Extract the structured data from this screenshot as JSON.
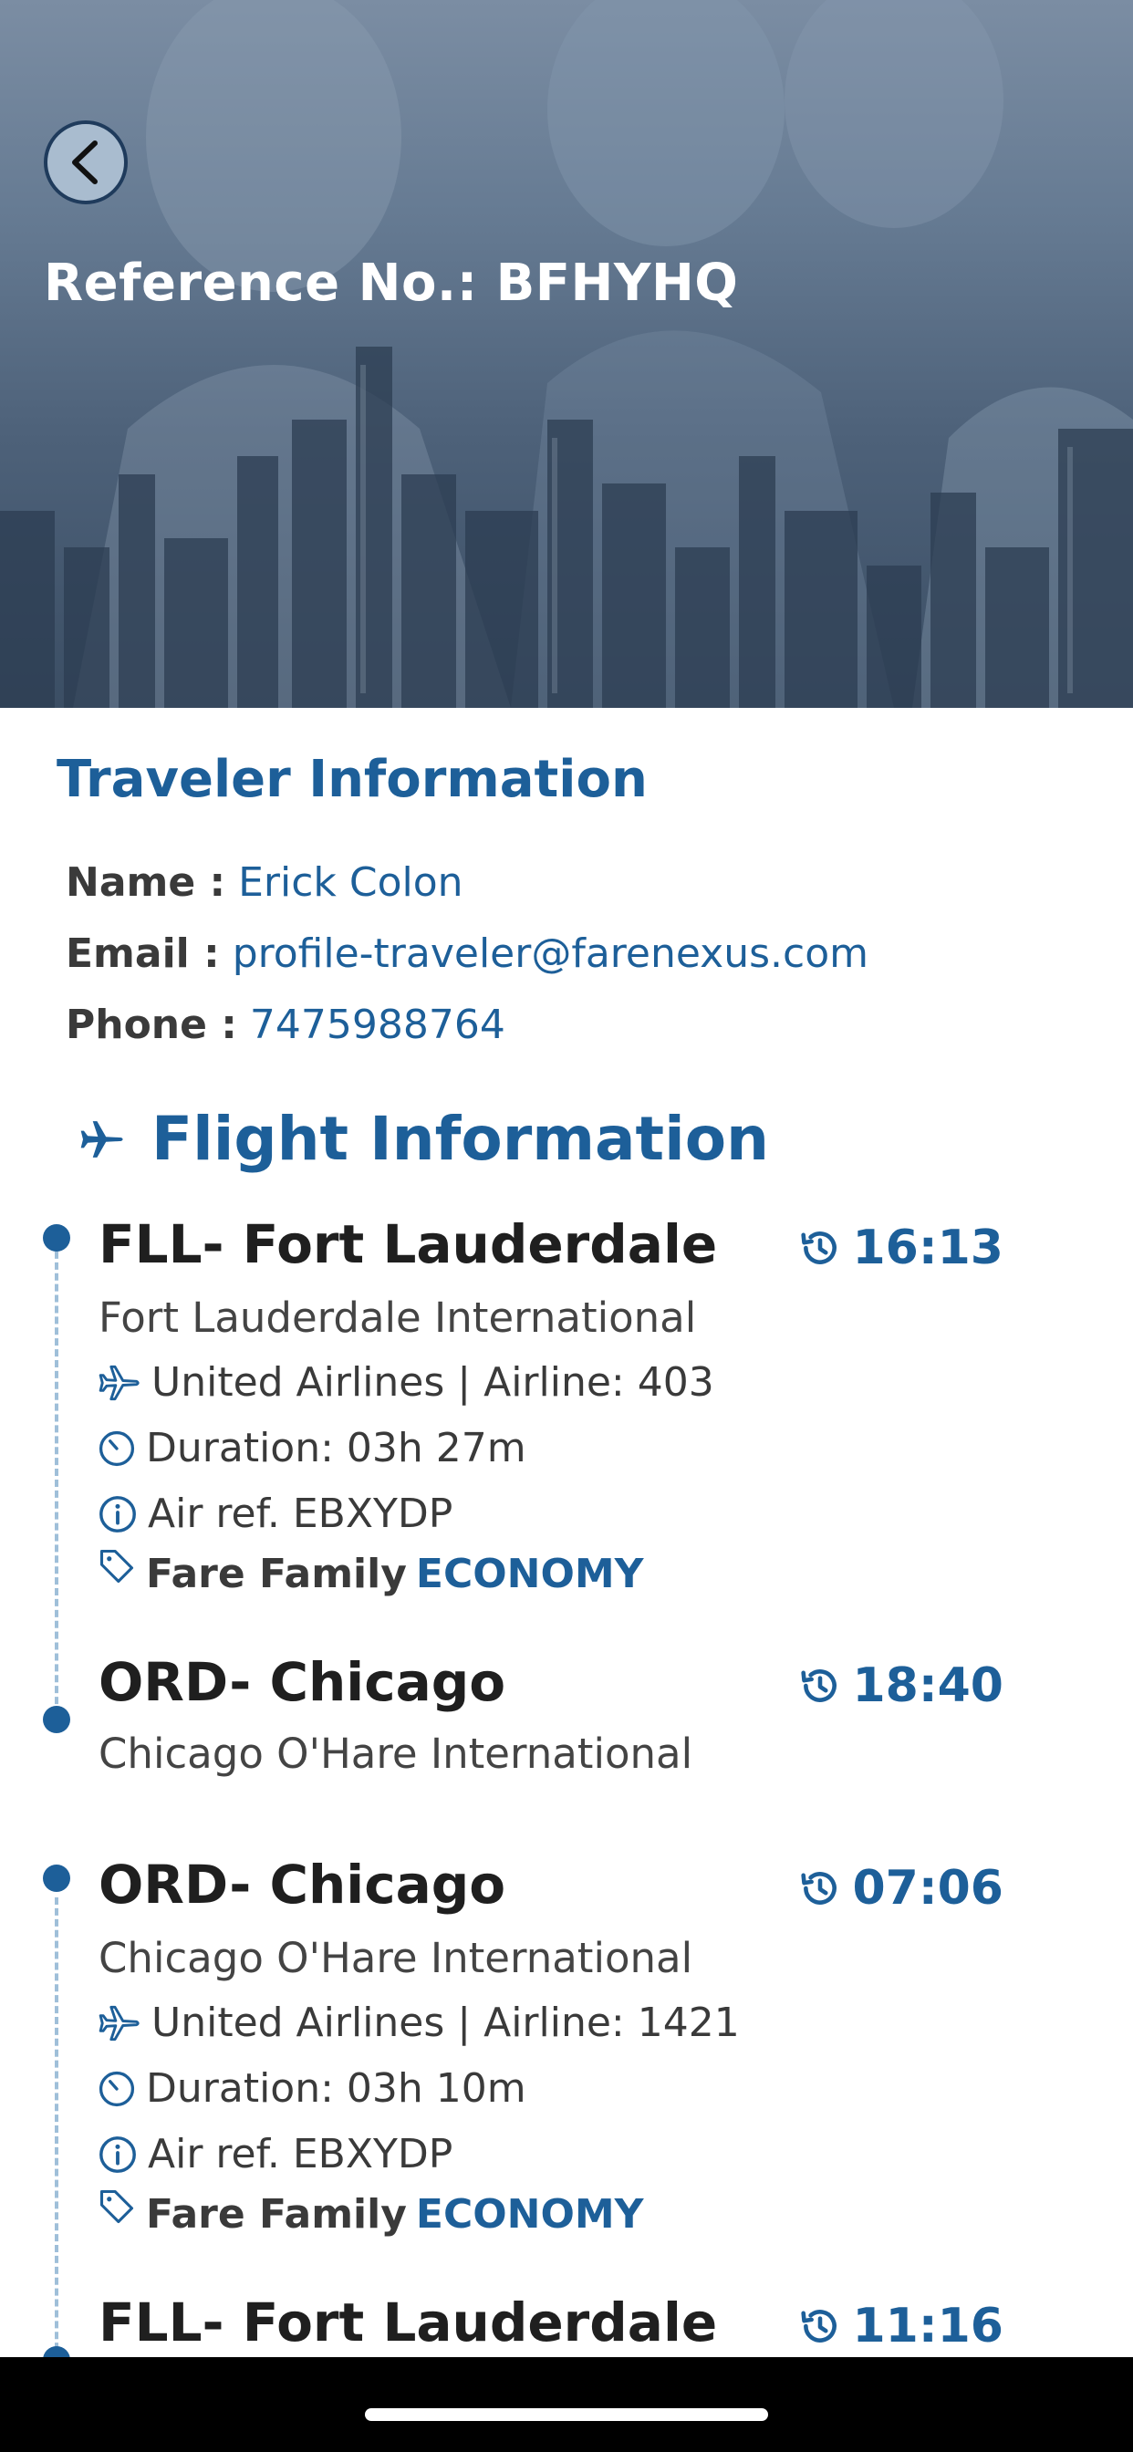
{
  "header": {
    "reference_title": "Reference No.: BFHYHQ",
    "back_icon": "chevron-left-icon"
  },
  "traveler": {
    "title": "Traveler Information",
    "name_label": "Name :",
    "name_value": "Erick Colon",
    "email_label": "Email :",
    "email_value": "profile-traveler@farenexus.com",
    "phone_label": "Phone :",
    "phone_value": "7475988764"
  },
  "flight": {
    "title": "Flight Information",
    "title_icon": "airplane-icon",
    "segments": [
      {
        "departure": {
          "city": "FLL- Fort Lauderdale",
          "airport": "Fort Lauderdale International",
          "time": "16:13"
        },
        "airline": "United Airlines | Airline: 403",
        "duration": "Duration: 03h 27m",
        "air_ref": "Air ref. EBXYDP",
        "fare_family_label": "Fare Family",
        "fare_family_value": "ECONOMY",
        "arrival": {
          "city": "ORD- Chicago",
          "airport": "Chicago O'Hare International",
          "time": "18:40"
        }
      },
      {
        "departure": {
          "city": "ORD- Chicago",
          "airport": "Chicago O'Hare International",
          "time": "07:06"
        },
        "airline": "United Airlines | Airline: 1421",
        "duration": "Duration: 03h 10m",
        "air_ref": "Air ref. EBXYDP",
        "fare_family_label": "Fare Family",
        "fare_family_value": "ECONOMY",
        "arrival": {
          "city": "FLL- Fort Lauderdale",
          "time": "11:16"
        }
      }
    ]
  },
  "colors": {
    "accent": "#1d5f99",
    "text_dark": "#1f1f1f",
    "text_body": "#444444",
    "timeline": "#9fbfd9"
  }
}
